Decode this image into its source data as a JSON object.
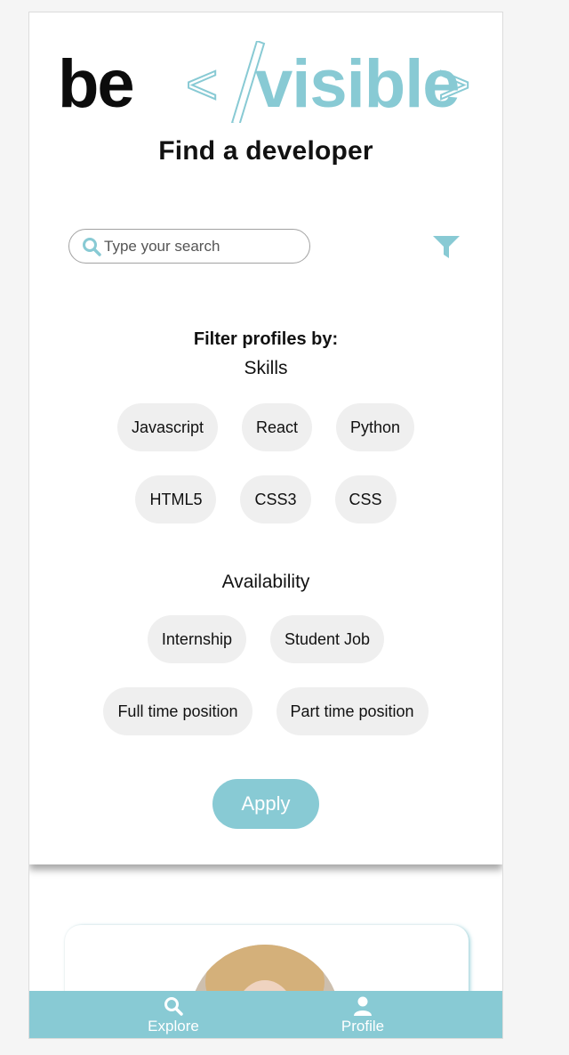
{
  "brand": {
    "logo_text": "be </visible>"
  },
  "header": {
    "title": "Find a developer"
  },
  "search": {
    "placeholder": "Type your search",
    "value": ""
  },
  "filters": {
    "heading": "Filter profiles by:",
    "skills_title": "Skills",
    "skills_row1": [
      "Javascript",
      "React",
      "Python"
    ],
    "skills_row2": [
      "HTML5",
      "CSS3",
      "CSS"
    ],
    "availability_title": "Availability",
    "availability_row1": [
      "Internship",
      "Student Job"
    ],
    "availability_row2": [
      "Full time position",
      "Part time position"
    ],
    "apply_label": "Apply"
  },
  "nav": {
    "explore_label": "Explore",
    "profile_label": "Profile"
  },
  "colors": {
    "accent": "#88cad4",
    "chip_bg": "#efefef",
    "text": "#111111"
  },
  "icons": [
    "search-icon",
    "filter-icon",
    "explore-search-icon",
    "profile-person-icon"
  ]
}
